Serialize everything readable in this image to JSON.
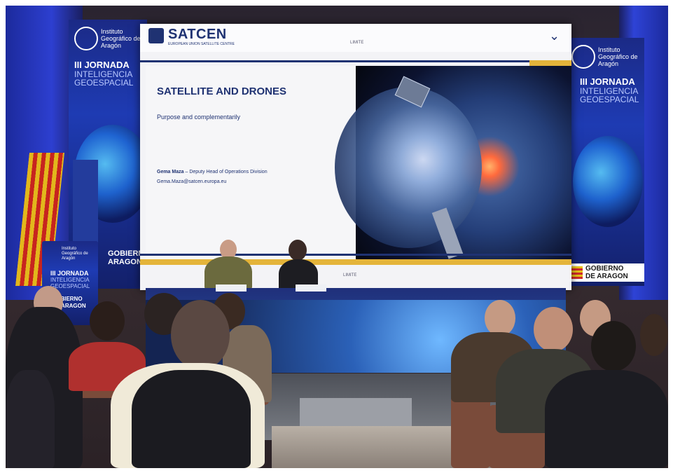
{
  "banner_left": {
    "institute": "Instituto Geográfico de Aragón",
    "event_line1": "III JORNADA",
    "event_line2": "INTELIGENCIA",
    "event_line3": "GEOESPACIAL",
    "gov_line1": "GOBIERNO",
    "gov_line2": "ARAGON"
  },
  "banner_right": {
    "institute": "Instituto Geográfico de Aragón",
    "event_line1": "III JORNADA",
    "event_line2": "INTELIGENCIA",
    "event_line3": "GEOESPACIAL",
    "gov_line1": "GOBIERNO",
    "gov_line2": "DE ARAGON"
  },
  "podium_sign": {
    "institute": "Instituto Geográfico de Aragón",
    "event_line1": "III JORNADA",
    "event_line2": "INTELIGENCIA",
    "event_line3": "GEOESPACIAL",
    "gov_line1": "GOBIERNO",
    "gov_line2": "DE ARAGON"
  },
  "slide": {
    "brand": "SATCEN",
    "brand_sub": "EUROPEAN UNION SATELLITE CENTRE",
    "classification_top": "LIMITE",
    "classification_bottom": "LIMITE",
    "title": "SATELLITE AND DRONES",
    "subtitle": "Purpose and complementarily",
    "presenter_name": "Gema Maza",
    "presenter_role": " – Deputy Head of Operations Division",
    "presenter_email": "Gema.Maza@satcen.europa.eu"
  },
  "colors": {
    "navy": "#1f3272",
    "gold": "#e4b43a",
    "banner_blue": "#1e3bb3"
  }
}
